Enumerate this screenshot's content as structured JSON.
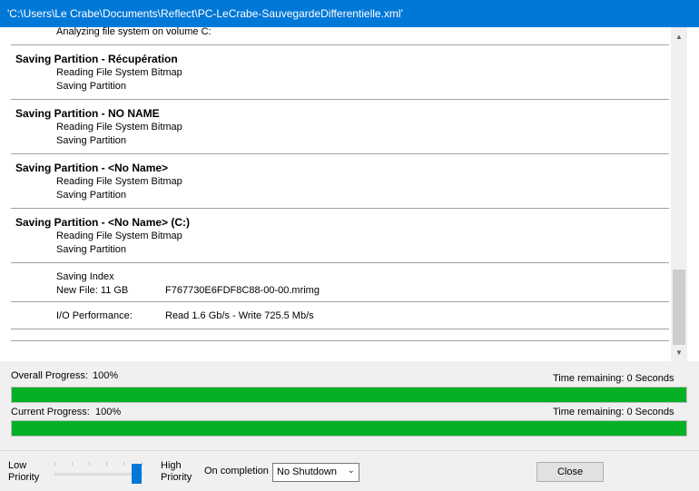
{
  "window": {
    "title": "'C:\\Users\\Le Crabe\\Documents\\Reflect\\PC-LeCrabe-SauvegardeDifferentielle.xml'"
  },
  "log": {
    "top_line": "Analyzing file system on volume C:",
    "sections": [
      {
        "header": "Saving Partition - Récupération",
        "lines": [
          "Reading File System Bitmap",
          "Saving Partition"
        ]
      },
      {
        "header": "Saving Partition - NO NAME",
        "lines": [
          "Reading File System Bitmap",
          "Saving Partition"
        ]
      },
      {
        "header": "Saving Partition - <No Name>",
        "lines": [
          "Reading File System Bitmap",
          "Saving Partition"
        ]
      },
      {
        "header": "Saving Partition - <No Name> (C:)",
        "lines": [
          "Reading File System Bitmap",
          "Saving Partition"
        ]
      }
    ],
    "saving_index": "Saving Index",
    "new_file_label": "New File: 11 GB",
    "new_file_name": "F767730E6FDF8C88-00-00.mrimg",
    "io_label": "I/O Performance:",
    "io_value": "Read 1.6 Gb/s - Write 725.5 Mb/s"
  },
  "progress": {
    "overall": {
      "label": "Overall Progress:",
      "percent_text": "100%",
      "time_remaining": "Time remaining: 0 Seconds",
      "fraction": 1.0
    },
    "current": {
      "label": "Current Progress:",
      "percent_text": "100%",
      "time_remaining": "Time remaining: 0 Seconds",
      "fraction": 1.0
    }
  },
  "controls": {
    "priority_low": "Low\nPriority",
    "priority_high": "High\nPriority",
    "priority_level": 1.0,
    "on_completion_label": "On completion",
    "on_completion_value": "No Shutdown",
    "close_label": "Close"
  },
  "colors": {
    "titlebar": "#0078d7",
    "progress_fill": "#06b025",
    "slider_thumb": "#0078d7"
  },
  "icons": {
    "scroll_up": "chevron-up-icon",
    "scroll_down": "chevron-down-icon",
    "select_dropdown": "chevron-down-icon"
  }
}
